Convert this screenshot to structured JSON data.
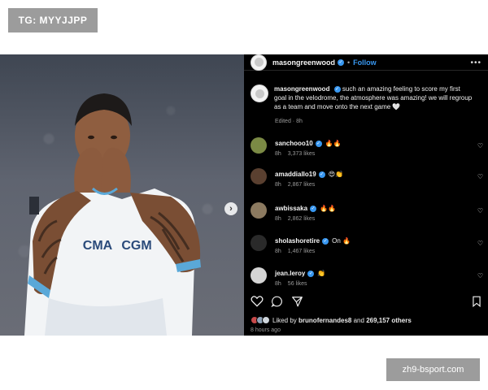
{
  "watermark": {
    "top_label": "TG: MYYJJPP",
    "bottom_label": "zh9-bsport.com"
  },
  "post": {
    "author": "masongreenwood",
    "follow_label": "Follow",
    "dot": "•",
    "more_label": "•••",
    "caption_text": "such an amazing feeling to score my first goal in the velodrome, the atmosphere was amazing! we will regroup as a team and move onto the next game 🤍",
    "edited_label": "Edited · 8h",
    "jersey_text": "CMA CGM",
    "next_label": "›",
    "comments": [
      {
        "user": "sanchooo10",
        "emoji": "🔥🔥",
        "time": "8h",
        "likes": "3,373 likes",
        "avatar_color": "#7b8a45"
      },
      {
        "user": "amaddiallo19",
        "emoji": "😍👏",
        "time": "8h",
        "likes": "2,867 likes",
        "avatar_color": "#5a4030"
      },
      {
        "user": "awbissaka",
        "emoji": "🔥🔥",
        "time": "8h",
        "likes": "2,862 likes",
        "avatar_color": "#8c7a60"
      },
      {
        "user": "sholashoretire",
        "emoji": "On 🔥",
        "time": "8h",
        "likes": "1,467 likes",
        "avatar_color": "#2a2a2a"
      },
      {
        "user": "jean.leroy",
        "emoji": "👏",
        "time": "8h",
        "likes": "56 likes",
        "avatar_color": "#d5d5d5"
      }
    ],
    "liked_by_prefix": "Liked by",
    "liked_by_user": "brunofernandes8",
    "liked_by_conj": "and",
    "liked_by_count": "269,157 others",
    "posted_time": "8 hours ago",
    "heart_glyph": "♡"
  },
  "colors": {
    "accent": "#3897f0",
    "panel_bg": "#000000",
    "watermark_bg": "#9c9c9c"
  },
  "icons": [
    "heart-icon",
    "comment-icon",
    "share-icon",
    "bookmark-icon",
    "verified-icon",
    "next-arrow-icon"
  ]
}
